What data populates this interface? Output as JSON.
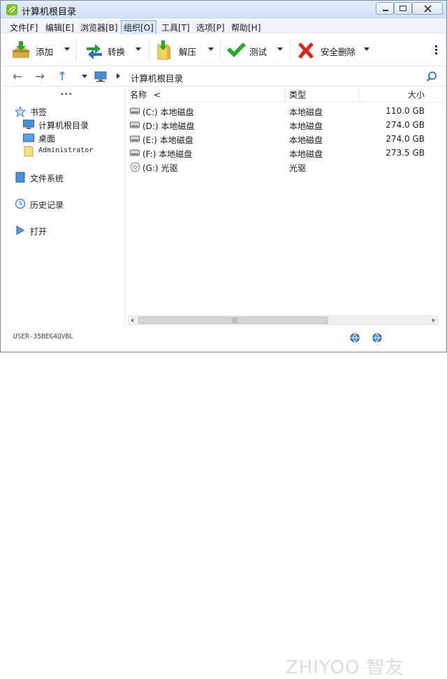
{
  "window": {
    "title": "计算机根目录",
    "accent": "#3b7fd0"
  },
  "menu": [
    {
      "label": "文件[F]"
    },
    {
      "label": "编辑[E]"
    },
    {
      "label": "浏览器[B]"
    },
    {
      "label": "组织[O]"
    },
    {
      "label": "工具[T]"
    },
    {
      "label": "选项[P]"
    },
    {
      "label": "帮助[H]"
    }
  ],
  "toolbar": {
    "add": "添加",
    "convert": "转换",
    "extract": "解压",
    "test": "测试",
    "secure_delete": "安全删除",
    "more_icon": "more-vertical-icon"
  },
  "address": {
    "path": "计算机根目录"
  },
  "sidebar": {
    "more": "•••",
    "bookmarks": "书签",
    "bookmark_items": [
      "计算机根目录",
      "桌面",
      "Administrator"
    ],
    "filesystem": "文件系统",
    "history": "历史记录",
    "open": "打开"
  },
  "columns": {
    "name": "名称",
    "type": "类型",
    "size": "大小",
    "sort_indicator": "<"
  },
  "rows": [
    {
      "name": "(C:) 本地磁盘",
      "type": "本地磁盘",
      "size": "110.0 GB",
      "icon": "drive-icon"
    },
    {
      "name": "(D:) 本地磁盘",
      "type": "本地磁盘",
      "size": "274.0 GB",
      "icon": "drive-icon"
    },
    {
      "name": "(E:) 本地磁盘",
      "type": "本地磁盘",
      "size": "274.0 GB",
      "icon": "drive-icon"
    },
    {
      "name": "(F:) 本地磁盘",
      "type": "本地磁盘",
      "size": "273.5 GB",
      "icon": "drive-icon"
    },
    {
      "name": "(G:) 光驱",
      "type": "光驱",
      "size": "",
      "icon": "optical-drive-icon"
    }
  ],
  "status": {
    "computer": "USER-35BEG4QVBL",
    "watermark": "ZHIYOO 智友"
  }
}
